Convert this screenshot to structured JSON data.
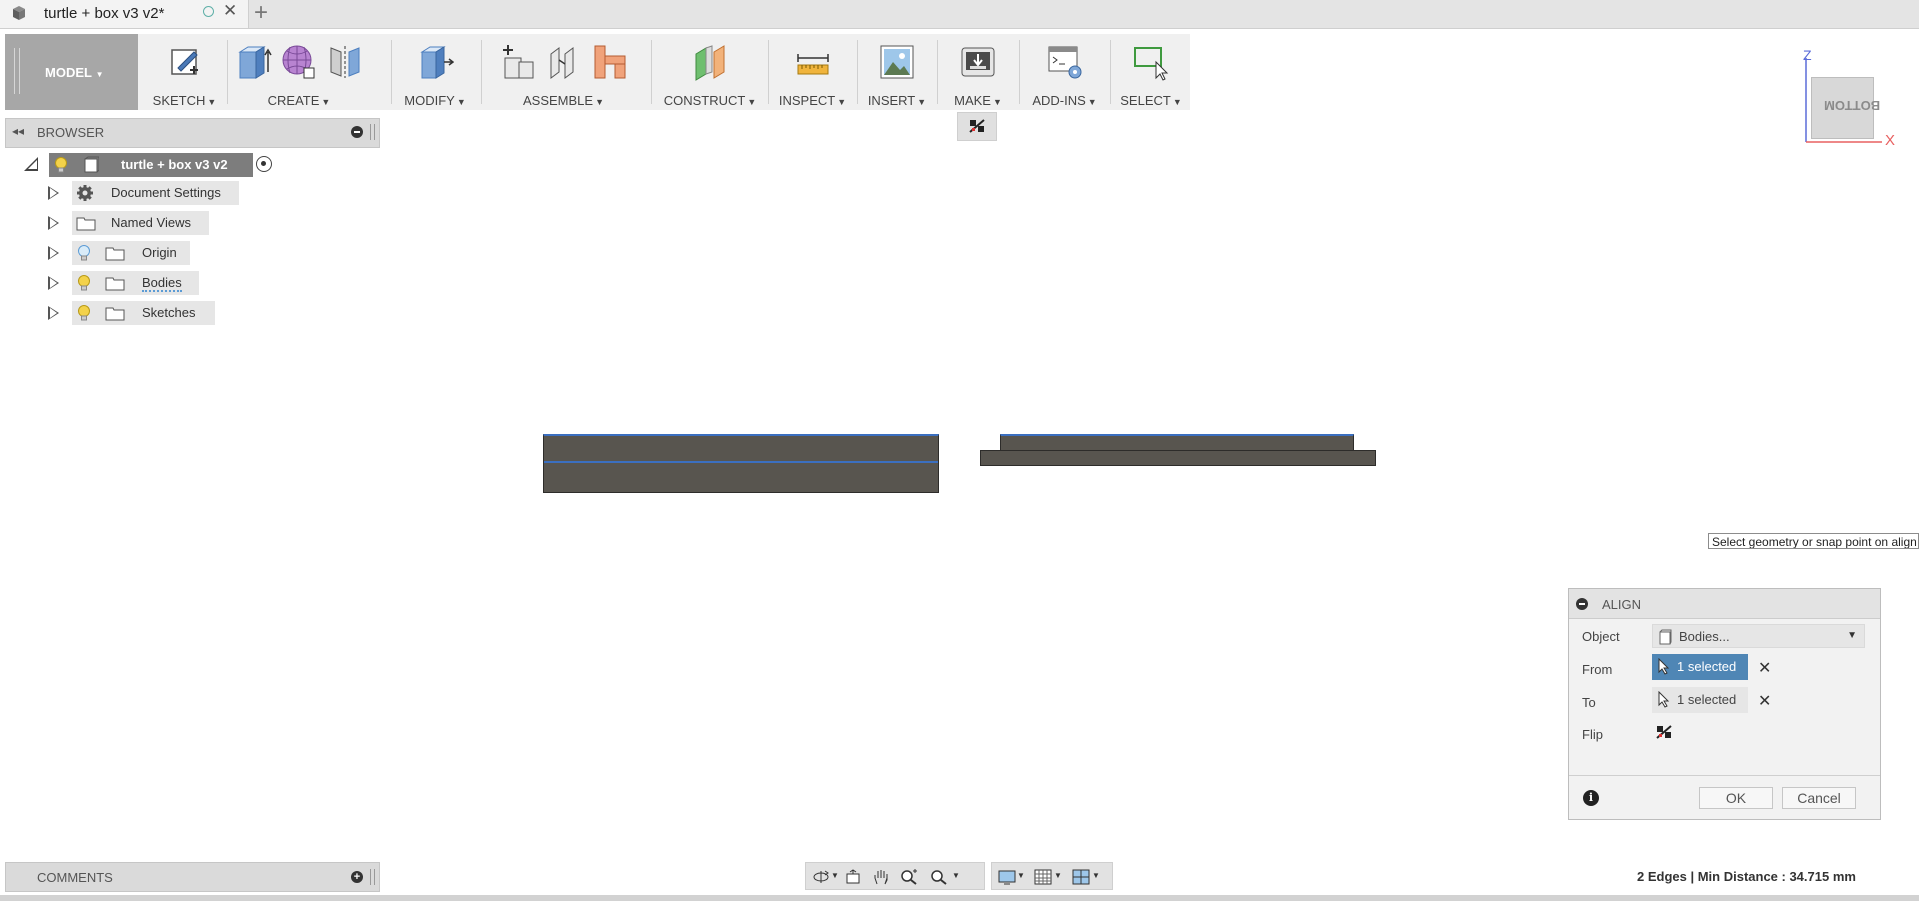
{
  "tab": {
    "title": "turtle + box v3 v2*"
  },
  "toolbar": {
    "workspace": "MODEL",
    "groups": [
      {
        "id": "sketch",
        "label": "SKETCH"
      },
      {
        "id": "create",
        "label": "CREATE"
      },
      {
        "id": "modify",
        "label": "MODIFY"
      },
      {
        "id": "assemble",
        "label": "ASSEMBLE"
      },
      {
        "id": "construct",
        "label": "CONSTRUCT"
      },
      {
        "id": "inspect",
        "label": "INSPECT"
      },
      {
        "id": "insert",
        "label": "INSERT"
      },
      {
        "id": "make",
        "label": "MAKE"
      },
      {
        "id": "addins",
        "label": "ADD-INS"
      },
      {
        "id": "select",
        "label": "SELECT"
      }
    ]
  },
  "browser": {
    "title": "BROWSER",
    "root": "turtle + box v3 v2",
    "items": [
      {
        "label": "Document Settings",
        "icon": "gear-icon"
      },
      {
        "label": "Named Views",
        "icon": "folder-icon"
      },
      {
        "label": "Origin",
        "icon": "folder-icon"
      },
      {
        "label": "Bodies",
        "icon": "folder-icon"
      },
      {
        "label": "Sketches",
        "icon": "folder-icon"
      }
    ]
  },
  "viewcube": {
    "face": "BOTTOM",
    "axis_z": "Z",
    "axis_x": "X"
  },
  "tooltip": "Select geometry or snap point on align",
  "align": {
    "title": "ALIGN",
    "object_label": "Object",
    "object_value": "Bodies...",
    "from_label": "From",
    "from_value": "1 selected",
    "to_label": "To",
    "to_value": "1 selected",
    "flip_label": "Flip",
    "ok": "OK",
    "cancel": "Cancel"
  },
  "comments": {
    "title": "COMMENTS"
  },
  "status": "2 Edges | Min Distance : 34.715 mm",
  "colors": {
    "selection_edge": "#3b6fc0",
    "body": "#58554f",
    "active_button": "#4f86b5"
  }
}
